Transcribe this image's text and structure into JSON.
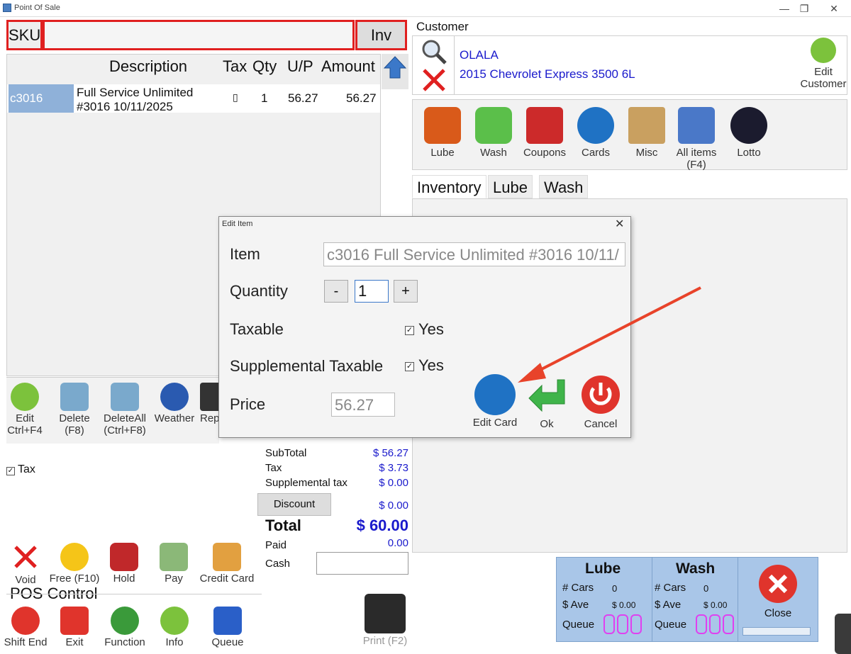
{
  "window": {
    "title": "Point Of Sale",
    "min": "—",
    "max": "❐",
    "close": "✕"
  },
  "sku": {
    "label": "SKU",
    "value": "",
    "inv_label": "Inv"
  },
  "grid": {
    "headers": [
      "Description",
      "Tax",
      "Qty",
      "U/P",
      "Amount"
    ],
    "rows": [
      {
        "sku": "c3016",
        "desc1": "Full Service Unlimited",
        "desc2": "#3016 10/11/2025",
        "tax": "▯",
        "qty": "1",
        "up": "56.27",
        "amount": "56.27"
      }
    ]
  },
  "customer": {
    "heading": "Customer",
    "name": "OLALA",
    "vehicle": "2015 Chevrolet Express 3500 6L",
    "edit_label": "Edit Customer"
  },
  "categories": [
    "Lube",
    "Wash",
    "Coupons",
    "Cards",
    "Misc",
    "All items (F4)",
    "Lotto"
  ],
  "tabs": [
    "Inventory",
    "Lube",
    "Wash"
  ],
  "tools": [
    "Edit Ctrl+F4",
    "Delete (F8)",
    "DeleteAll (Ctrl+F8)",
    "Weather",
    "Rep"
  ],
  "tax_check": "Tax",
  "totals": {
    "subtotal_label": "SubTotal",
    "subtotal": "$ 56.27",
    "tax_label": "Tax",
    "tax": "$ 3.73",
    "supp_label": "Supplemental tax",
    "supp": "$ 0.00",
    "discount_label": "Discount",
    "discount": "$ 0.00",
    "total_label": "Total",
    "total": "$ 60.00",
    "paid_label": "Paid",
    "paid": "0.00",
    "cash_label": "Cash",
    "cash": ""
  },
  "actions": [
    "Void",
    "Free (F10)",
    "Hold",
    "Pay",
    "Credit Card"
  ],
  "pos_control": {
    "heading": "POS Control",
    "buttons": [
      "Shift End",
      "Exit",
      "Function",
      "Info",
      "Queue"
    ]
  },
  "print_label": "Print (F2)",
  "dialog": {
    "title": "Edit Item",
    "item_label": "Item",
    "item_value": "c3016 Full Service Unlimited #3016 10/11/",
    "qty_label": "Quantity",
    "qty_value": "1",
    "minus": "-",
    "plus": "+",
    "taxable_label": "Taxable",
    "taxable_value": "Yes",
    "supp_label": "Supplemental Taxable",
    "supp_value": "Yes",
    "price_label": "Price",
    "price_value": "56.27",
    "edit_card": "Edit Card",
    "ok": "Ok",
    "cancel": "Cancel"
  },
  "queue": {
    "lube": {
      "title": "Lube",
      "cars_label": "# Cars",
      "cars": "0",
      "ave_label": "$ Ave",
      "ave": "$ 0.00",
      "queue_label": "Queue"
    },
    "wash": {
      "title": "Wash",
      "cars_label": "# Cars",
      "cars": "0",
      "ave_label": "$ Ave",
      "ave": "$ 0.00",
      "queue_label": "Queue"
    },
    "close_label": "Close"
  },
  "colors": {
    "accent_red": "#e02020",
    "blue_text": "#1a1acc",
    "queue_bg": "#a9c6e8",
    "digit": "#e040f0"
  }
}
